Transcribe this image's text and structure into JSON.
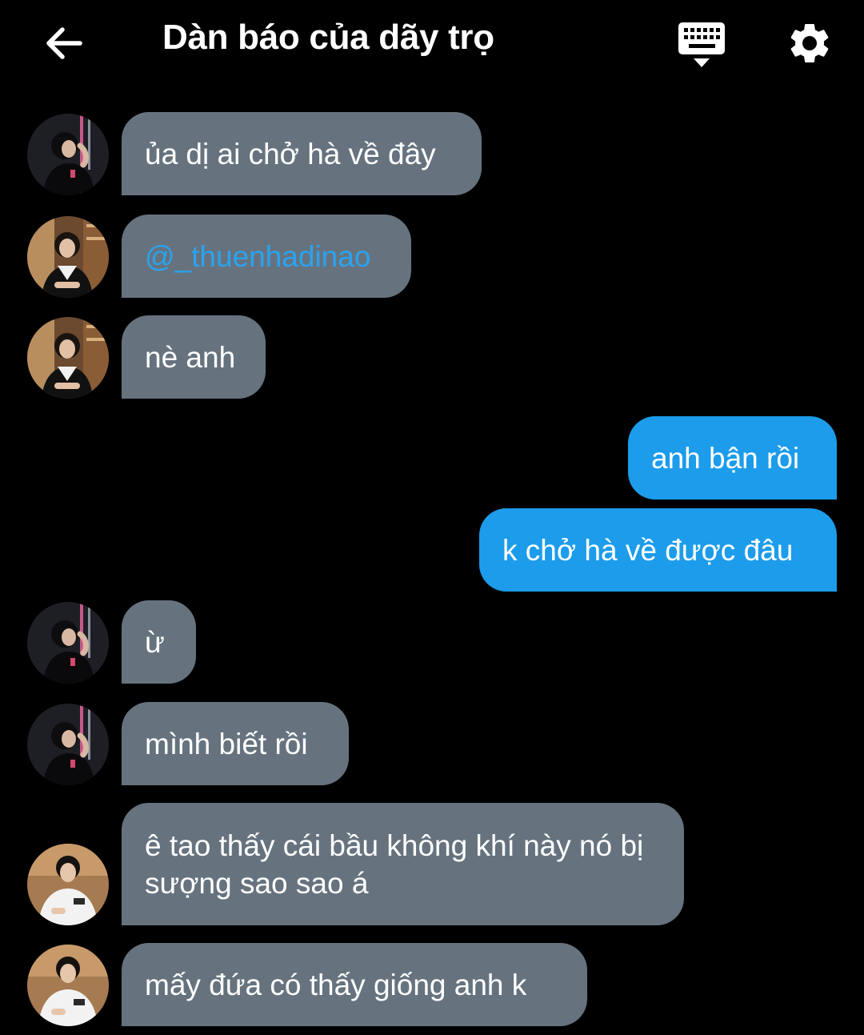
{
  "header": {
    "title": "Dàn báo của dãy trọ",
    "back_icon": "arrow-left-icon",
    "keyboard_icon": "keyboard-icon",
    "settings_icon": "gear-icon"
  },
  "colors": {
    "background": "#000000",
    "incoming_bubble": "#66737f",
    "outgoing_bubble": "#1c9ceb",
    "mention": "#2aa3ef"
  },
  "messages": [
    {
      "direction": "in",
      "avatar": "avatar-a",
      "text": "ủa dị ai chở hà về đây"
    },
    {
      "direction": "in",
      "avatar": "avatar-b",
      "text": "@_thuenhadinao"
    },
    {
      "direction": "in",
      "avatar": "avatar-b",
      "text": "nè anh"
    },
    {
      "direction": "out",
      "text": "anh bận rồi"
    },
    {
      "direction": "out",
      "text": "k chở hà về được đâu"
    },
    {
      "direction": "in",
      "avatar": "avatar-a",
      "text": "ừ"
    },
    {
      "direction": "in",
      "avatar": "avatar-a",
      "text": "mình biết rồi"
    },
    {
      "direction": "in",
      "avatar": "avatar-c",
      "text": "ê tao thấy cái bầu không khí này nó bị sượng sao sao á"
    },
    {
      "direction": "in",
      "avatar": "avatar-c",
      "text": "mấy đứa có thấy giống anh k"
    }
  ]
}
